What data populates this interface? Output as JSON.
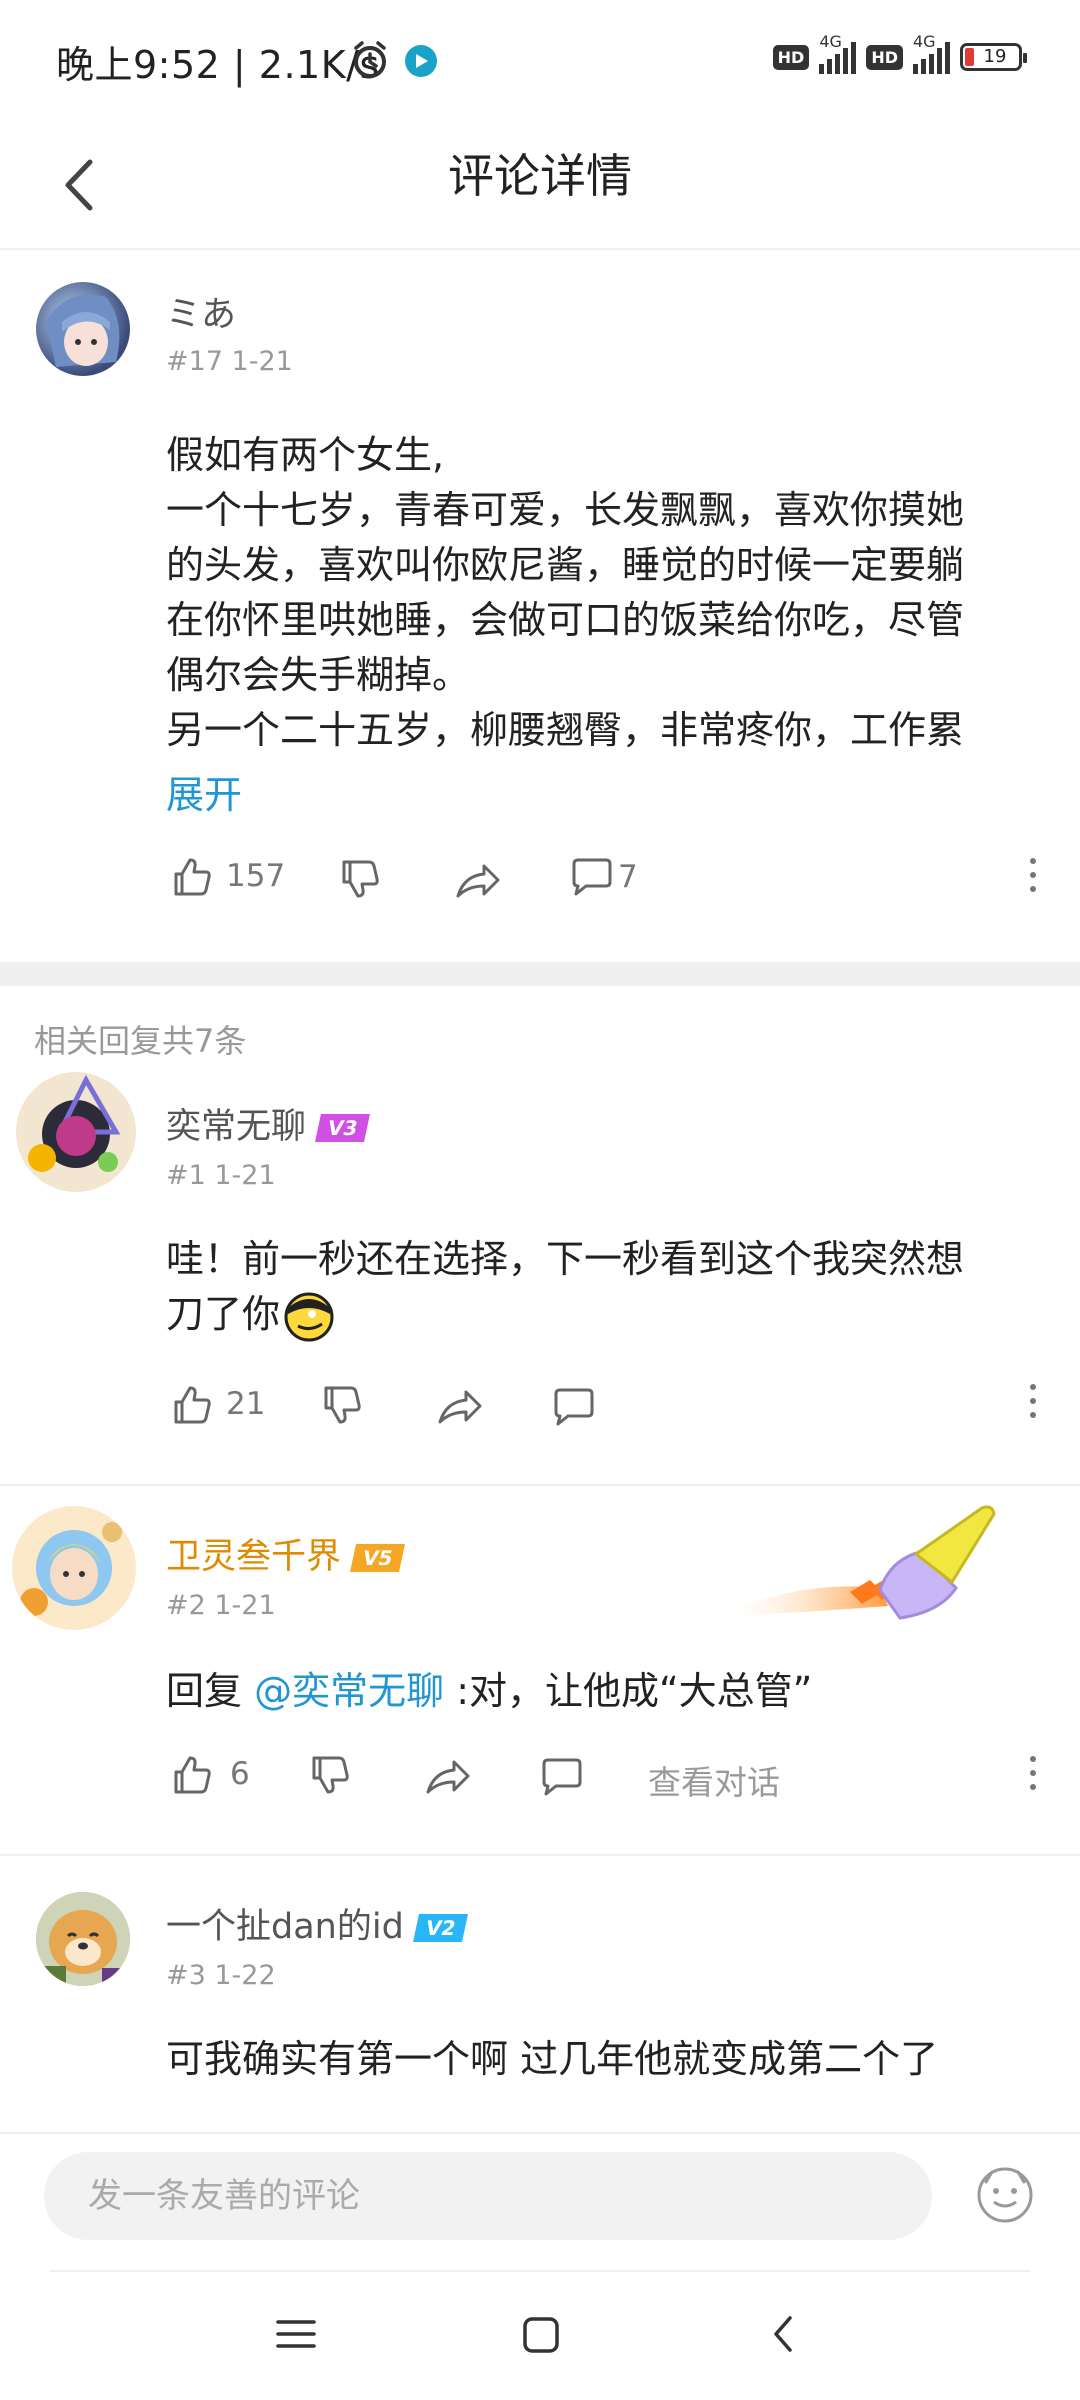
{
  "status": {
    "time_speed": "晚上9:52 | 2.1K/s",
    "battery": "19",
    "net1": "4G",
    "net2": "4G",
    "hd": "HD"
  },
  "header": {
    "title": "评论详情"
  },
  "main_comment": {
    "user": "ミあ",
    "meta": "#17   1-21",
    "text_lines": [
      "假如有两个女生,",
      "一个十七岁，青春可爱，长发飘飘，喜欢你摸她",
      "的头发，喜欢叫你欧尼酱，睡觉的时候一定要躺",
      "在你怀里哄她睡，会做可口的饭菜给你吃，尽管",
      "偶尔会失手糊掉。",
      "另一个二十五岁，柳腰翘臀，非常疼你，工作累"
    ],
    "expand": "展开",
    "likes": "157",
    "replies": "7"
  },
  "replies_header": "相关回复共7条",
  "replies": [
    {
      "user": "奕常无聊",
      "level": "V3",
      "meta": "#1   1-21",
      "text_lines": [
        "哇！前一秒还在选择，下一秒看到这个我突然想",
        "刀了你"
      ],
      "likes": "21"
    },
    {
      "user": "卫灵叁千界",
      "level": "V5",
      "meta": "#2   1-21",
      "reply_prefix": "回复 ",
      "mention": "@奕常无聊",
      "text": " :对，让他成“大总管”",
      "likes": "6",
      "view_dialog": "查看对话"
    },
    {
      "user": "一个扯dan的id",
      "level": "V2",
      "meta": "#3   1-22",
      "text": "可我确实有第一个啊 过几年他就变成第二个了"
    }
  ],
  "input": {
    "placeholder": "发一条友善的评论"
  },
  "colors": {
    "accent": "#2196d3",
    "v3": "#d24fe6",
    "v5": "#f5a623",
    "v2": "#29b6f6",
    "vip_name": "#e08a00"
  }
}
